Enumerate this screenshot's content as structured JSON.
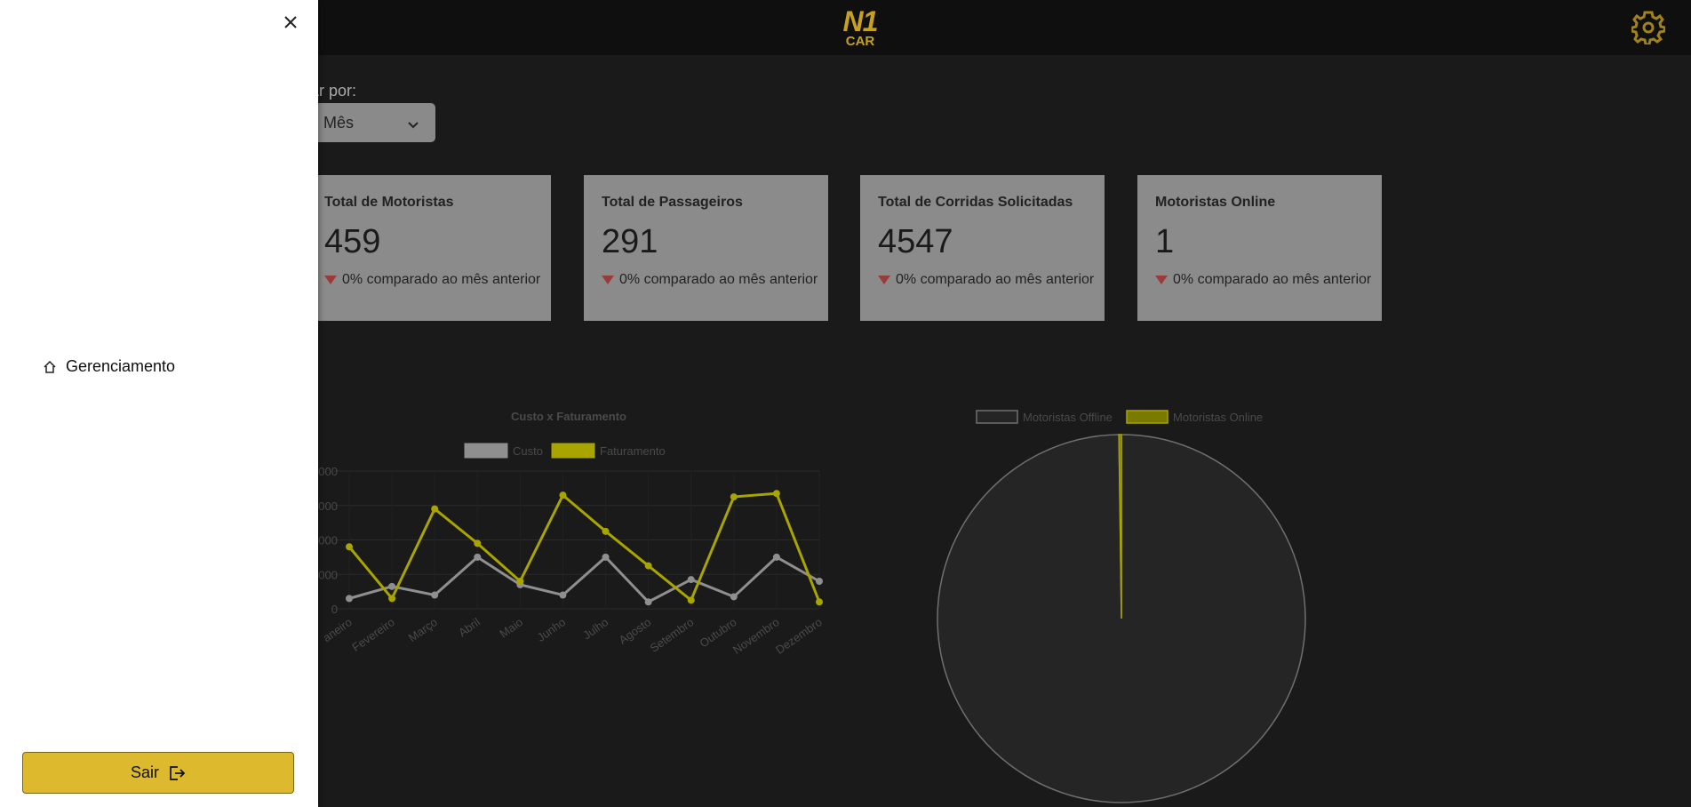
{
  "header": {
    "logo_main": "N1",
    "logo_sub": "CAR"
  },
  "filter": {
    "label": "ltrar por:",
    "selected": "Mês"
  },
  "cards": [
    {
      "title": "Total de Motoristas",
      "value": "459",
      "delta": "0% comparado ao mês anterior"
    },
    {
      "title": "Total de Passageiros",
      "value": "291",
      "delta": "0% comparado ao mês anterior"
    },
    {
      "title": "Total de Corridas Solicitadas",
      "value": "4547",
      "delta": "0% comparado ao mês anterior"
    },
    {
      "title": "Motoristas Online",
      "value": "1",
      "delta": "0% comparado ao mês anterior"
    }
  ],
  "sidebar": {
    "items": [
      {
        "label": "Gerenciamento",
        "icon": "home-icon"
      }
    ],
    "logout_label": "Sair"
  },
  "colors": {
    "accent": "#ddb92e",
    "series_cost": "#8f8f8f",
    "series_revenue": "#a8a400",
    "delta_down": "#9a3b3b"
  },
  "chart_data": [
    {
      "type": "line",
      "title": "Custo x Faturamento",
      "categories": [
        "aneiro",
        "Fevereiro",
        "Março",
        "Abril",
        "Maio",
        "Junho",
        "Julho",
        "Agosto",
        "Setembro",
        "Outubro",
        "Novembro",
        "Dezembro"
      ],
      "y_tick_labels": [
        "0",
        "000",
        "000",
        "000",
        "000"
      ],
      "series": [
        {
          "name": "Custo",
          "values": [
            0.6,
            1.3,
            0.8,
            3.0,
            1.4,
            0.8,
            3.0,
            0.4,
            1.7,
            0.7,
            3.0,
            1.6
          ]
        },
        {
          "name": "Faturamento",
          "values": [
            3.6,
            0.6,
            5.8,
            3.8,
            1.6,
            6.6,
            4.5,
            2.5,
            0.5,
            6.5,
            6.7,
            0.4
          ]
        }
      ],
      "ylim": [
        0,
        8
      ]
    },
    {
      "type": "pie",
      "legend": [
        "Motoristas Offline",
        "Motoristas Online"
      ],
      "values": [
        458,
        1
      ]
    }
  ]
}
